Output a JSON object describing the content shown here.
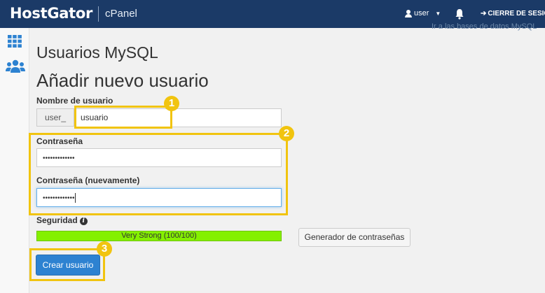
{
  "header": {
    "logo": "HostGator",
    "product": "cPanel",
    "user_label": "user",
    "logout_label": "CIERRE DE SESIÓN"
  },
  "sidebar": {
    "icons": [
      "grid-icon",
      "users-icon"
    ]
  },
  "main": {
    "db_link": "Ir a las bases de datos MySQL",
    "page_title": "Usuarios MySQL",
    "section_title": "Añadir nuevo usuario",
    "username_label": "Nombre de usuario",
    "username_prefix": "user_",
    "username_value": "usuario",
    "password_label": "Contraseña",
    "password_value": "•••••••••••••",
    "password_again_label": "Contraseña (nuevamente)",
    "password_again_value": "•••••••••••••",
    "strength_label": "Seguridad",
    "strength_text": "Very Strong (100/100)",
    "strength_value": 100,
    "generator_button": "Generador de contraseñas",
    "create_button": "Crear usuario"
  },
  "callouts": [
    "1",
    "2",
    "3"
  ],
  "colors": {
    "header_bg": "#1b3a67",
    "accent": "#2d82d1",
    "callout": "#f1c40f",
    "strength_bar": "#84f000"
  }
}
